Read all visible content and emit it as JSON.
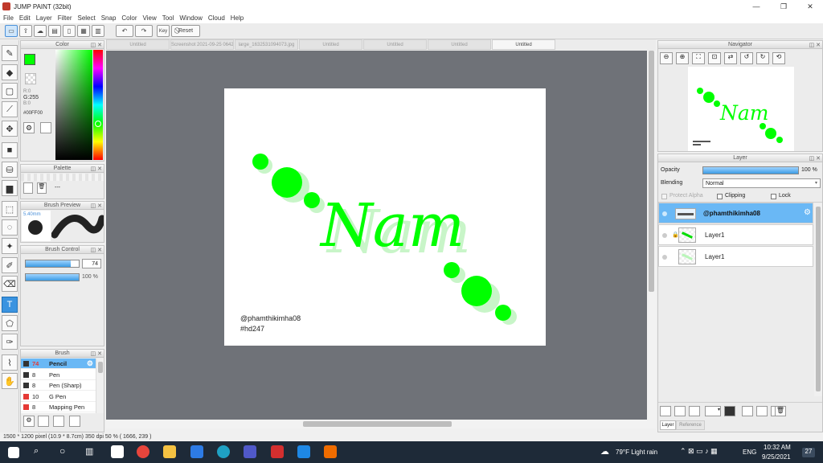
{
  "window": {
    "title": "JUMP PAINT (32bit)",
    "minimize": "—",
    "maximize": "❐",
    "close": "✕"
  },
  "menu": [
    "File",
    "Edit",
    "Layer",
    "Filter",
    "Select",
    "Snap",
    "Color",
    "View",
    "Tool",
    "Window",
    "Cloud",
    "Help"
  ],
  "toolbar": {
    "key_label": "Key",
    "reset_label": "Reset"
  },
  "tabs": [
    "Untitled",
    "Screenshot 2021-09-25 064243.png",
    "large_1632531094073.jpg",
    "Untitled",
    "Untitled",
    "Untitled",
    "Untitled"
  ],
  "color_panel": {
    "title": "Color",
    "r": "R:0",
    "g": "G:255",
    "b": "B:0",
    "hex": "#00FF00",
    "fg_color": "#00ff00"
  },
  "palette_panel": {
    "title": "Palette",
    "value": "---"
  },
  "brush_preview": {
    "title": "Brush Preview",
    "size": "5.40mm"
  },
  "brush_control": {
    "title": "Brush Control",
    "size_value": "74",
    "size_level": 0.85,
    "opacity_value": "100 %",
    "opacity_level": 1.0
  },
  "brush_panel": {
    "title": "Brush",
    "items": [
      {
        "size": "74",
        "name": "Pencil",
        "color": "#333333"
      },
      {
        "size": "8",
        "name": "Pen",
        "color": "#333333"
      },
      {
        "size": "8",
        "name": "Pen (Sharp)",
        "color": "#333333"
      },
      {
        "size": "10",
        "name": "G Pen",
        "color": "#e53935"
      },
      {
        "size": "8",
        "name": "Mapping Pen",
        "color": "#e53935"
      }
    ]
  },
  "canvas": {
    "script_text": "Nam",
    "signature": "@phamthikimha08",
    "tag": "#hd247",
    "accent": "#00ff00"
  },
  "navigator": {
    "title": "Navigator"
  },
  "layer_panel": {
    "title": "Layer",
    "opacity_label": "Opacity",
    "opacity_value": "100 %",
    "opacity_level": 1.0,
    "blending_label": "Blending",
    "blending_value": "Normal",
    "protect_alpha": "Protect Alpha",
    "clipping": "Clipping",
    "lock": "Lock",
    "layers": [
      {
        "name": "@phamthikimha08"
      },
      {
        "name": "Layer1"
      },
      {
        "name": "Layer1"
      }
    ],
    "tab_layer": "Layer",
    "tab_reference": "Reference"
  },
  "status_bar": {
    "text": "1500 * 1200 pixel   (10.9 * 8.7cm)   350 dpi   50 %   ( 1666, 239 )"
  },
  "taskbar": {
    "weather": "79°F  Light rain",
    "lang": "ENG",
    "time": "10:32 AM",
    "date": "9/25/2021",
    "notif": "27"
  }
}
